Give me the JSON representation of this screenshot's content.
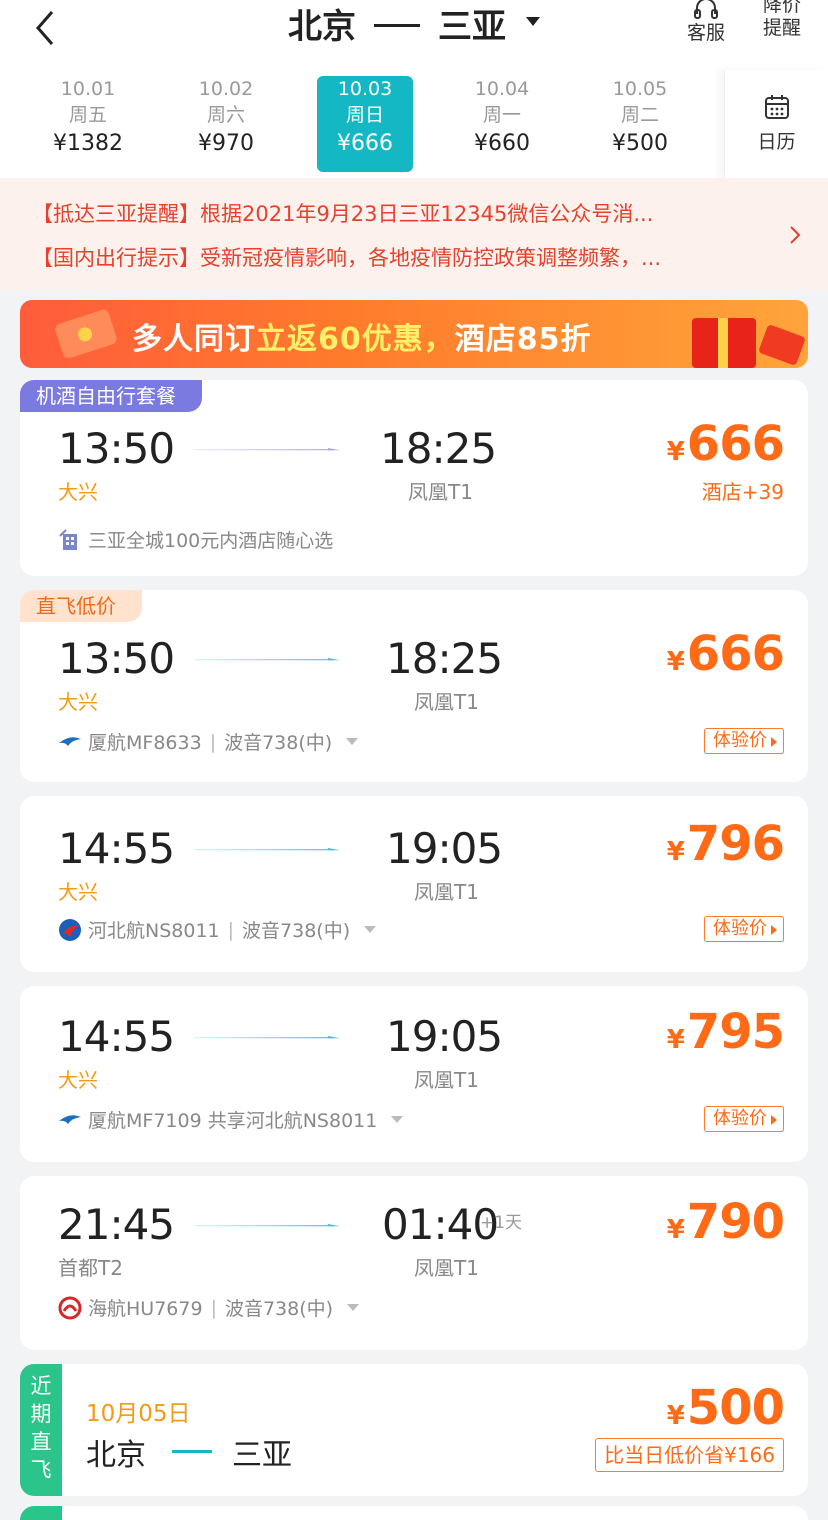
{
  "header": {
    "from": "北京",
    "to": "三亚",
    "service_label": "客服",
    "alert_label_1": "降价",
    "alert_label_2": "提醒"
  },
  "dates": [
    {
      "date": "10.01",
      "weekday": "周五",
      "price": "¥1382",
      "selected": false
    },
    {
      "date": "10.02",
      "weekday": "周六",
      "price": "¥970",
      "selected": false
    },
    {
      "date": "10.03",
      "weekday": "周日",
      "price": "¥666",
      "selected": true
    },
    {
      "date": "10.04",
      "weekday": "周一",
      "price": "¥660",
      "selected": false
    },
    {
      "date": "10.05",
      "weekday": "周二",
      "price": "¥500",
      "selected": false
    }
  ],
  "calendar_label": "日历",
  "notices": [
    "【抵达三亚提醒】根据2021年9月23日三亚12345微信公众号消...",
    "【国内出行提示】受新冠疫情影响，各地疫情防控政策调整频繁，..."
  ],
  "banner": {
    "text_a": "多人同订",
    "text_b": "立返60优惠，",
    "text_c": "酒店85折"
  },
  "flights": [
    {
      "tag": "机酒自由行套餐",
      "dep_time": "13:50",
      "dep_airport": "大兴",
      "arr_time": "18:25",
      "arr_airport": "凤凰T1",
      "currency": "¥",
      "price": "666",
      "extra": "酒店+39",
      "info": "三亚全城100元内酒店随心选"
    },
    {
      "tag": "直飞低价",
      "dep_time": "13:50",
      "dep_airport": "大兴",
      "arr_time": "18:25",
      "arr_airport": "凤凰T1",
      "currency": "¥",
      "price": "666",
      "airline": "厦航MF8633",
      "aircraft": "波音738(中)",
      "badge": "体验价"
    },
    {
      "dep_time": "14:55",
      "dep_airport": "大兴",
      "arr_time": "19:05",
      "arr_airport": "凤凰T1",
      "currency": "¥",
      "price": "796",
      "airline": "河北航NS8011",
      "aircraft": "波音738(中)",
      "badge": "体验价"
    },
    {
      "dep_time": "14:55",
      "dep_airport": "大兴",
      "arr_time": "19:05",
      "arr_airport": "凤凰T1",
      "currency": "¥",
      "price": "795",
      "airline": "厦航MF7109 共享河北航NS8011",
      "badge": "体验价"
    },
    {
      "dep_time": "21:45",
      "dep_airport": "首都T2",
      "arr_time": "01:40",
      "plus_day": "+1天",
      "arr_airport": "凤凰T1",
      "currency": "¥",
      "price": "790",
      "airline": "海航HU7679",
      "aircraft": "波音738(中)"
    }
  ],
  "nearby": {
    "side_label": [
      "近",
      "期",
      "直",
      "飞"
    ],
    "date": "10月05日",
    "from": "北京",
    "to": "三亚",
    "currency": "¥",
    "price": "500",
    "save": "比当日低价省¥166"
  },
  "colors": {
    "accent": "#14b8c4",
    "price": "#ff6a16",
    "notice": "#e5412c",
    "package_tag": "#7a7ae0",
    "nearby_side": "#2bc48a"
  }
}
